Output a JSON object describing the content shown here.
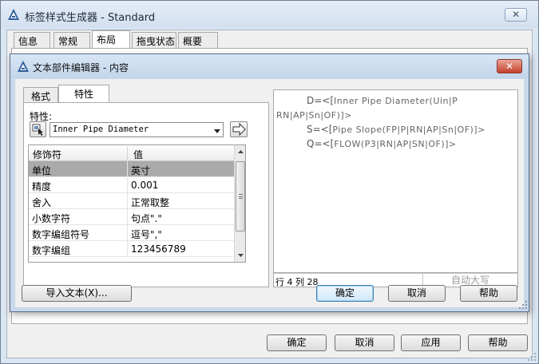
{
  "outer_window": {
    "title": "标签样式生成器 - Standard",
    "close_label": "✕",
    "tabs": [
      {
        "label": "信息"
      },
      {
        "label": "常规"
      },
      {
        "label": "布局"
      },
      {
        "label": "拖曳状态"
      },
      {
        "label": "概要"
      }
    ],
    "active_tab": "布局",
    "buttons": {
      "ok": "确定",
      "cancel": "取消",
      "apply": "应用",
      "help": "帮助"
    }
  },
  "dialog": {
    "title": "文本部件编辑器 - 内容",
    "close_label": "✕",
    "tabs": [
      {
        "label": "格式"
      },
      {
        "label": "特性"
      }
    ],
    "active_tab": "特性",
    "property_label": "特性:",
    "property_selected": "Inner Pipe Diameter",
    "grid": {
      "headers": [
        "修饰符",
        "值"
      ],
      "rows": [
        {
          "modifier": "单位",
          "value": "英寸"
        },
        {
          "modifier": "精度",
          "value": "0.001"
        },
        {
          "modifier": "舍入",
          "value": "正常取整"
        },
        {
          "modifier": "小数字符",
          "value": "句点\".\""
        },
        {
          "modifier": "数字编组符号",
          "value": "逗号\",\""
        },
        {
          "modifier": "数字编组",
          "value": "123456789"
        }
      ],
      "selected_row": 0
    },
    "editor": {
      "lines": [
        {
          "prefix": "D=<[",
          "field": "Inner Pipe Diameter(Uin|P"
        },
        {
          "prefix": "",
          "field": "RN|AP|Sn|OF)]>"
        },
        {
          "prefix": "S=<[",
          "field": "Pipe Slope(FP|P|RN|AP|Sn|OF)]>"
        },
        {
          "prefix": "Q=<[",
          "field": "FLOW(P3|RN|AP|SN|OF)]>"
        }
      ]
    },
    "status": {
      "position": "行 4 列 28",
      "autocaps": "自动大写"
    },
    "buttons": {
      "import": "导入文本(X)...",
      "ok": "确定",
      "cancel": "取消",
      "help": "帮助"
    }
  },
  "colors": {
    "titlebar_blue": "#d3e0ef",
    "close_red": "#c2412c",
    "selected_row": "#aaaaaa"
  }
}
